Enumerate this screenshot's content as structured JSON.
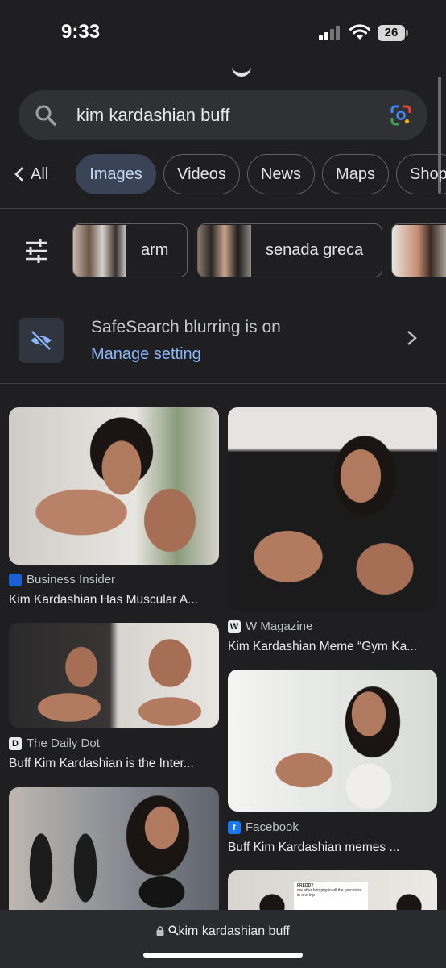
{
  "status": {
    "time": "9:33",
    "battery": "26"
  },
  "search": {
    "query": "kim kardashian buff"
  },
  "tabs": [
    {
      "label": "All"
    },
    {
      "label": "Images"
    },
    {
      "label": "Videos"
    },
    {
      "label": "News"
    },
    {
      "label": "Maps"
    },
    {
      "label": "Shop"
    }
  ],
  "chips": [
    {
      "label": "arm"
    },
    {
      "label": "senada greca"
    }
  ],
  "safesearch": {
    "title": "SafeSearch blurring is on",
    "link": "Manage setting"
  },
  "results": [
    {
      "source": "Business Insider",
      "title": "Kim Kardashian Has Muscular A..."
    },
    {
      "source": "W Magazine",
      "title": "Kim Kardashian Meme “Gym Ka..."
    },
    {
      "source": "The Daily Dot",
      "title": "Buff Kim Kardashian is the Inter..."
    },
    {
      "source": "Facebook",
      "title": "Buff Kim Kardashian memes ..."
    }
  ],
  "tweet_preview": {
    "name": "FREDDY",
    "text": "me after bringing in all the groceries in one trip"
  },
  "bottom": {
    "query": "kim kardashian buff"
  },
  "colors": {
    "background": "#1f1f21",
    "accent": "#8ab4f8",
    "active_tab": "#394457"
  }
}
